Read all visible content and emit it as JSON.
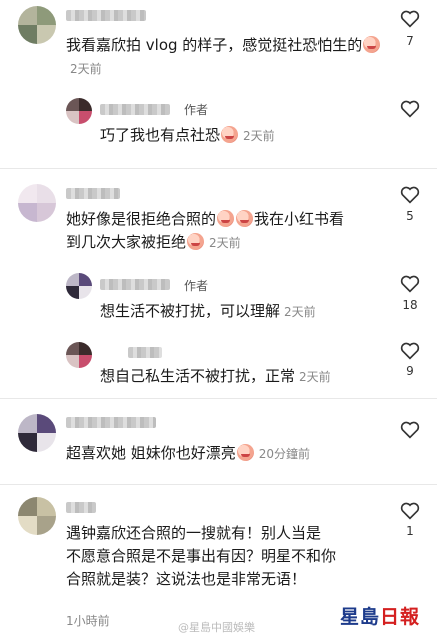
{
  "comments": [
    {
      "text": "我看嘉欣拍 vlog 的样子，感觉挺社恐怕生的",
      "time": "2天前",
      "likes": "7"
    },
    {
      "author_tag": "作者",
      "text": "巧了我也有点社恐",
      "time": "2天前",
      "likes": ""
    },
    {
      "text_line1": "她好像是很拒绝合照的",
      "text_line1b": "我在小红书看",
      "text_line2": "到几次大家被拒绝",
      "time": "2天前",
      "likes": "5"
    },
    {
      "author_tag": "作者",
      "text": "想生活不被打扰，可以理解",
      "time": "2天前",
      "likes": "18"
    },
    {
      "text": "想自己私生活不被打扰，正常",
      "time": "2天前",
      "likes": "9"
    },
    {
      "text": "超喜欢她 姐妹你也好漂亮",
      "time": "20分鐘前",
      "likes": ""
    },
    {
      "text_line1": "遇钟嘉欣还合照的一搜就有！别人当是",
      "text_line2": "不愿意合照是不是事出有因？明星不和你",
      "text_line3": "合照就是装？这说法也是非常无语！",
      "time": "1小時前",
      "likes": "1"
    }
  ],
  "logo": {
    "part1": "星島",
    "part2": "日報"
  },
  "watermark": "@星島中國娛樂"
}
